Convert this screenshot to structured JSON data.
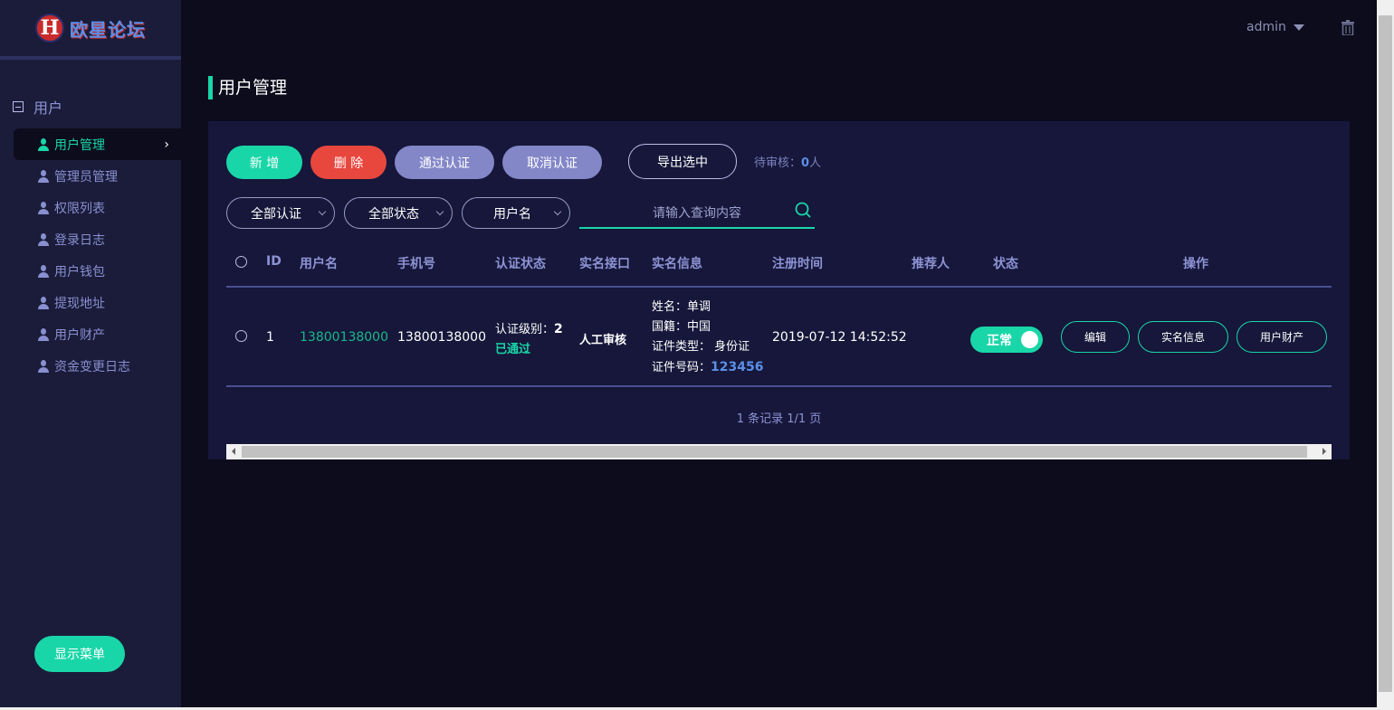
{
  "brand": {
    "logo_letter": "H",
    "name": "欧星论坛"
  },
  "topbar": {
    "user": "admin"
  },
  "sidebar": {
    "group_title": "用户",
    "items": [
      {
        "label": "用户管理",
        "active": true
      },
      {
        "label": "管理员管理"
      },
      {
        "label": "权限列表"
      },
      {
        "label": "登录日志"
      },
      {
        "label": "用户钱包"
      },
      {
        "label": "提现地址"
      },
      {
        "label": "用户财产"
      },
      {
        "label": "资金变更日志"
      }
    ],
    "show_menu_label": "显示菜单"
  },
  "page": {
    "title": "用户管理"
  },
  "toolbar": {
    "add_label": "新 增",
    "delete_label": "删 除",
    "approve_label": "通过认证",
    "cancel_label": "取消认证",
    "export_label": "导出选中",
    "pending_prefix": "待审核：",
    "pending_count": "0",
    "pending_suffix": "人"
  },
  "filters": {
    "cert_select": "全部认证",
    "status_select": "全部状态",
    "field_select": "用户名",
    "search_placeholder": "请输入查询内容"
  },
  "table": {
    "headers": [
      "ID",
      "用户名",
      "手机号",
      "认证状态",
      "实名接口",
      "实名信息",
      "注册时间",
      "推荐人",
      "状态",
      "操作"
    ],
    "rows": [
      {
        "id": "1",
        "username": "13800138000",
        "phone": "13800138000",
        "cert_level_label": "认证级别：",
        "cert_level": "2",
        "cert_status": "已通过",
        "interface": "人工审核",
        "realname_name": "姓名：单调",
        "realname_country": "国籍：中国",
        "realname_doc_type": "证件类型： 身份证",
        "realname_doc_label": "证件号码：",
        "realname_doc_no": "123456",
        "reg_time": "2019-07-12 14:52:52",
        "referrer": "",
        "status": "正常",
        "status_on": true,
        "actions": [
          "编辑",
          "实名信息",
          "用户财产"
        ]
      }
    ],
    "records_text": "1 条记录 1/1 页"
  },
  "colors": {
    "accent": "#19d6a8",
    "danger": "#e8473e",
    "secondary": "#8387c8",
    "bg": "#0c0c1c",
    "panel": "#16173a",
    "sidebar": "#1a1c3a",
    "link_blue": "#5b8fe8"
  },
  "icons": [
    "user-icon",
    "minus-box-icon",
    "chevron-right-icon",
    "chevron-down-icon",
    "search-icon",
    "trash-icon",
    "caret-down-icon"
  ]
}
